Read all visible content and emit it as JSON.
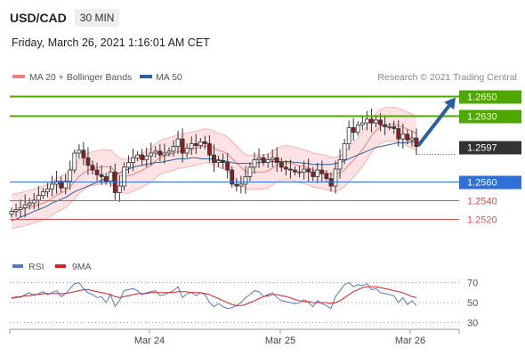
{
  "header": {
    "symbol": "USD/CAD",
    "timeframe": "30 MIN",
    "timestamp": "Friday, March 26, 2021 1:16:01 AM CET"
  },
  "legend_main": [
    {
      "label": "MA 20 + Bollinger Bands",
      "color": "#f08080"
    },
    {
      "label": "MA 50",
      "color": "#2c5f9e"
    }
  ],
  "legend_rsi": [
    {
      "label": "RSI",
      "color": "#5577cc"
    },
    {
      "label": "9MA",
      "color": "#e02020"
    }
  ],
  "copyright": "Research © 2021 Trading Central",
  "colors": {
    "resistance": "#4ea800",
    "pivot": "#2f6fd6",
    "support": "#e05050",
    "current": "#333333",
    "candle_up": "#ffffff",
    "candle_down": "#8a1f1f",
    "arrow": "#2c5f9e",
    "band_fill": "#fde3e3"
  },
  "chart_data": {
    "type": "candlestick",
    "instrument": "USD/CAD",
    "interval": "30 MIN",
    "ylim": [
      1.2505,
      1.2658
    ],
    "x_ticks": [
      "Mar 24",
      "Mar 25",
      "Mar 26"
    ],
    "levels": [
      {
        "value": 1.265,
        "label": "1.2650",
        "kind": "resistance"
      },
      {
        "value": 1.263,
        "label": "1.2630",
        "kind": "resistance"
      },
      {
        "value": 1.2597,
        "label": "1.2597",
        "kind": "current"
      },
      {
        "value": 1.256,
        "label": "1.2560",
        "kind": "pivot"
      },
      {
        "value": 1.254,
        "label": "1.2540",
        "kind": "support"
      },
      {
        "value": 1.252,
        "label": "1.2520",
        "kind": "support"
      }
    ],
    "target_arrow": {
      "from": 1.2597,
      "to": 1.265
    },
    "close_series": [
      1.2528,
      1.253,
      1.2532,
      1.2535,
      1.2537,
      1.254,
      1.2545,
      1.2549,
      1.2552,
      1.2557,
      1.256,
      1.2553,
      1.256,
      1.2572,
      1.259,
      1.2593,
      1.2585,
      1.2577,
      1.2572,
      1.2567,
      1.2565,
      1.256,
      1.257,
      1.2548,
      1.2555,
      1.2575,
      1.258,
      1.2585,
      1.2588,
      1.2583,
      1.2587,
      1.259,
      1.2592,
      1.2588,
      1.259,
      1.2592,
      1.2597,
      1.2605,
      1.259,
      1.2595,
      1.26,
      1.2598,
      1.2602,
      1.26,
      1.2588,
      1.258,
      1.2582,
      1.258,
      1.2572,
      1.2557,
      1.2555,
      1.2557,
      1.2565,
      1.2575,
      1.2583,
      1.2585,
      1.258,
      1.2583,
      1.2585,
      1.258,
      1.2575,
      1.2573,
      1.2572,
      1.257,
      1.257,
      1.2573,
      1.257,
      1.2565,
      1.2572,
      1.2568,
      1.2563,
      1.2555,
      1.2573,
      1.2583,
      1.26,
      1.2617,
      1.2612,
      1.262,
      1.2622,
      1.2626,
      1.2622,
      1.2625,
      1.262,
      1.2618,
      1.2618,
      1.2616,
      1.2605,
      1.261,
      1.2604,
      1.2606,
      1.2597
    ],
    "ma50_series": [
      1.2518,
      1.252,
      1.2522,
      1.2524,
      1.2526,
      1.2528,
      1.253,
      1.2532,
      1.2534,
      1.2537,
      1.2539,
      1.2541,
      1.2543,
      1.2546,
      1.2549,
      1.2551,
      1.2553,
      1.2555,
      1.2557,
      1.2559,
      1.2561,
      1.2563,
      1.2565,
      1.2567,
      1.2569,
      1.2571,
      1.2573,
      1.2575,
      1.2576,
      1.2577,
      1.2578,
      1.2579,
      1.258,
      1.258,
      1.2581,
      1.2582,
      1.2583,
      1.2584,
      1.2584,
      1.2584,
      1.2585,
      1.2585,
      1.2584,
      1.2584,
      1.2584,
      1.2583,
      1.2583,
      1.2582,
      1.2581,
      1.258,
      1.2579,
      1.2579,
      1.2579,
      1.2579,
      1.2579,
      1.258,
      1.258,
      1.2581,
      1.2581,
      1.2581,
      1.2581,
      1.2581,
      1.2581,
      1.258,
      1.258,
      1.2579,
      1.2579,
      1.2578,
      1.2578,
      1.2578,
      1.2578,
      1.2578,
      1.2579,
      1.258,
      1.2582,
      1.2584,
      1.2586,
      1.2588,
      1.259,
      1.2592,
      1.2594,
      1.2596,
      1.2597,
      1.2598,
      1.2599,
      1.26,
      1.2601,
      1.2601,
      1.2601,
      1.2602,
      1.2602
    ],
    "bb_width": 0.0018,
    "rsi": {
      "ylim": [
        25,
        75
      ],
      "levels": [
        70,
        50,
        30
      ],
      "rsi_values": [
        54,
        56,
        55,
        58,
        60,
        57,
        59,
        61,
        58,
        60,
        62,
        56,
        59,
        64,
        69,
        70,
        64,
        60,
        58,
        55,
        56,
        50,
        58,
        46,
        52,
        62,
        63,
        64,
        62,
        58,
        60,
        61,
        62,
        57,
        58,
        60,
        62,
        66,
        55,
        59,
        60,
        57,
        60,
        58,
        50,
        46,
        49,
        46,
        44,
        45,
        47,
        50,
        55,
        58,
        62,
        61,
        56,
        58,
        60,
        55,
        52,
        51,
        50,
        49,
        50,
        53,
        50,
        46,
        52,
        49,
        47,
        44,
        56,
        62,
        68,
        70,
        66,
        68,
        67,
        69,
        63,
        64,
        60,
        59,
        58,
        57,
        50,
        55,
        48,
        52,
        47
      ],
      "ma_values": [
        55,
        55,
        56,
        57,
        57,
        58,
        58,
        59,
        59,
        59,
        59,
        59,
        59,
        60,
        61,
        62,
        63,
        63,
        62,
        61,
        60,
        59,
        58,
        56,
        55,
        56,
        57,
        58,
        59,
        59,
        59,
        60,
        60,
        60,
        60,
        60,
        60,
        61,
        61,
        61,
        60,
        60,
        60,
        59,
        58,
        56,
        54,
        52,
        50,
        48,
        47,
        47,
        48,
        50,
        52,
        54,
        56,
        57,
        58,
        58,
        57,
        56,
        55,
        53,
        52,
        51,
        51,
        50,
        50,
        50,
        50,
        49,
        50,
        52,
        55,
        58,
        61,
        63,
        65,
        66,
        66,
        66,
        65,
        64,
        63,
        62,
        61,
        60,
        58,
        56,
        55
      ]
    }
  }
}
